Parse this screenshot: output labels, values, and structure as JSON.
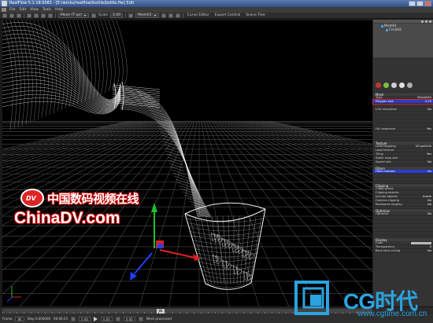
{
  "window": {
    "title": "RealFlow 5.1.18.0081 - [E:/works/realflow/bottle/bottle.flw] Edit"
  },
  "menu": [
    "File",
    "Edit",
    "View",
    "Tools",
    "Help"
  ],
  "toolbar": {
    "mode_select": "Move (T up)",
    "scale_label": "Scale",
    "scale_value": "1.00",
    "layout_select": "Mesh01",
    "buttons": [
      "Curve Editor",
      "Export Central",
      "Scene Tree"
    ]
  },
  "scene_tree": {
    "items": [
      {
        "label": "Mesh01",
        "level": 1
      },
      {
        "label": "Circle01",
        "level": 2
      }
    ]
  },
  "properties": {
    "sections": [
      {
        "title": "Mesh",
        "rows": [
          {
            "label": "Type",
            "value": "Renderkit"
          },
          {
            "label": "Polygon size",
            "value": "0.25",
            "state": "selected"
          },
          {
            "label": "",
            "value": ""
          },
          {
            "label": "LOD resolution",
            "value": "No"
          },
          {
            "label": "",
            "value": "",
            "state": "dim"
          },
          {
            "label": "",
            "value": "",
            "state": "dim"
          },
          {
            "label": "",
            "value": "",
            "state": "dim"
          },
          {
            "label": "",
            "value": "",
            "state": "dim"
          },
          {
            "label": "Full sequence",
            "value": "Yes"
          },
          {
            "label": "",
            "value": "",
            "state": "dim"
          },
          {
            "label": "",
            "value": "",
            "state": "dim"
          }
        ]
      },
      {
        "title": "Texture",
        "rows": [
          {
            "label": "UVW Mapping",
            "value": "UV particle"
          },
          {
            "label": "Load texture",
            "value": ""
          },
          {
            "label": "Tiling",
            "value": "Yes"
          },
          {
            "label": "Static map size",
            "value": ""
          },
          {
            "label": "Speed info",
            "value": "No"
          }
        ]
      },
      {
        "title": "Filters",
        "rows": [
          {
            "label": "Filter method",
            "value": "No",
            "state": "selected2"
          },
          {
            "label": "",
            "value": "",
            "state": "dim"
          },
          {
            "label": "",
            "value": "",
            "state": "dim"
          }
        ]
      },
      {
        "title": "Clipping",
        "rows": [
          {
            "label": "Clipping box",
            "value": ""
          },
          {
            "label": "Clipping objects",
            "value": ""
          },
          {
            "label": "Include objects",
            "value": "Inside"
          },
          {
            "label": "Camera clipping",
            "value": "No"
          },
          {
            "label": "Realworld clipping",
            "value": "No"
          }
        ]
      },
      {
        "title": "Optimize",
        "rows": [
          {
            "label": "Optimize",
            "value": "No"
          },
          {
            "label": "",
            "value": "",
            "state": "dim"
          },
          {
            "label": "",
            "value": "",
            "state": "dim"
          },
          {
            "label": "",
            "value": "",
            "state": "dim"
          },
          {
            "label": "",
            "value": "",
            "state": "dim"
          },
          {
            "label": "",
            "value": "",
            "state": "dim"
          }
        ]
      },
      {
        "title": "Display",
        "rows": [
          {
            "label": "Color",
            "value": "",
            "bar": true
          },
          {
            "label": "Transparency",
            "value": "0"
          },
          {
            "label": "Back face culling",
            "value": "No"
          }
        ]
      }
    ]
  },
  "timeline": {
    "current_frame": "86"
  },
  "status": {
    "frame_label": "Frame",
    "frame_value": "86",
    "step_text": "Step 0.000000",
    "time_text": "00:00:25",
    "field_a": "0.00",
    "field_b": "0.00",
    "field_c": "0.00",
    "message": "Mesh processed"
  },
  "watermarks": {
    "chinadv_logo": "DV",
    "chinadv_cn": "中国数码视频在线",
    "chinadv_en": "ChinaDV.com",
    "cg_brand": "CG时代",
    "cg_url": "www.cgtime.com.cn"
  },
  "colors": {
    "axis_x": "#e02020",
    "axis_y": "#20c030",
    "axis_z": "#2040ff",
    "selection": "#2a3bd0",
    "highlight_border": "#e02020"
  }
}
